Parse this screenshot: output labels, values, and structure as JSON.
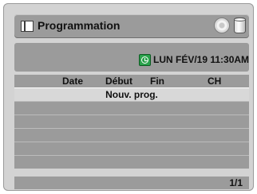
{
  "header": {
    "title": "Programmation",
    "icons": [
      "timer-program-icon",
      "disc-icon",
      "hdd-icon"
    ]
  },
  "status": {
    "clock_icon": "clock-icon",
    "datetime": "LUN FÉV/19 11:30AM"
  },
  "table": {
    "columns": [
      "Date",
      "Début",
      "Fin",
      "CH"
    ],
    "rows": [
      {
        "label": "Nouv. prog.",
        "selected": true
      },
      {
        "label": ""
      },
      {
        "label": ""
      },
      {
        "label": ""
      },
      {
        "label": ""
      },
      {
        "label": ""
      }
    ]
  },
  "footer": {
    "page": "1/1"
  },
  "colors": {
    "background": "#d3d3d3",
    "panel": "#9b9b9b",
    "selected_row": "#d8d8d8",
    "clock_green": "#2aa24b"
  }
}
